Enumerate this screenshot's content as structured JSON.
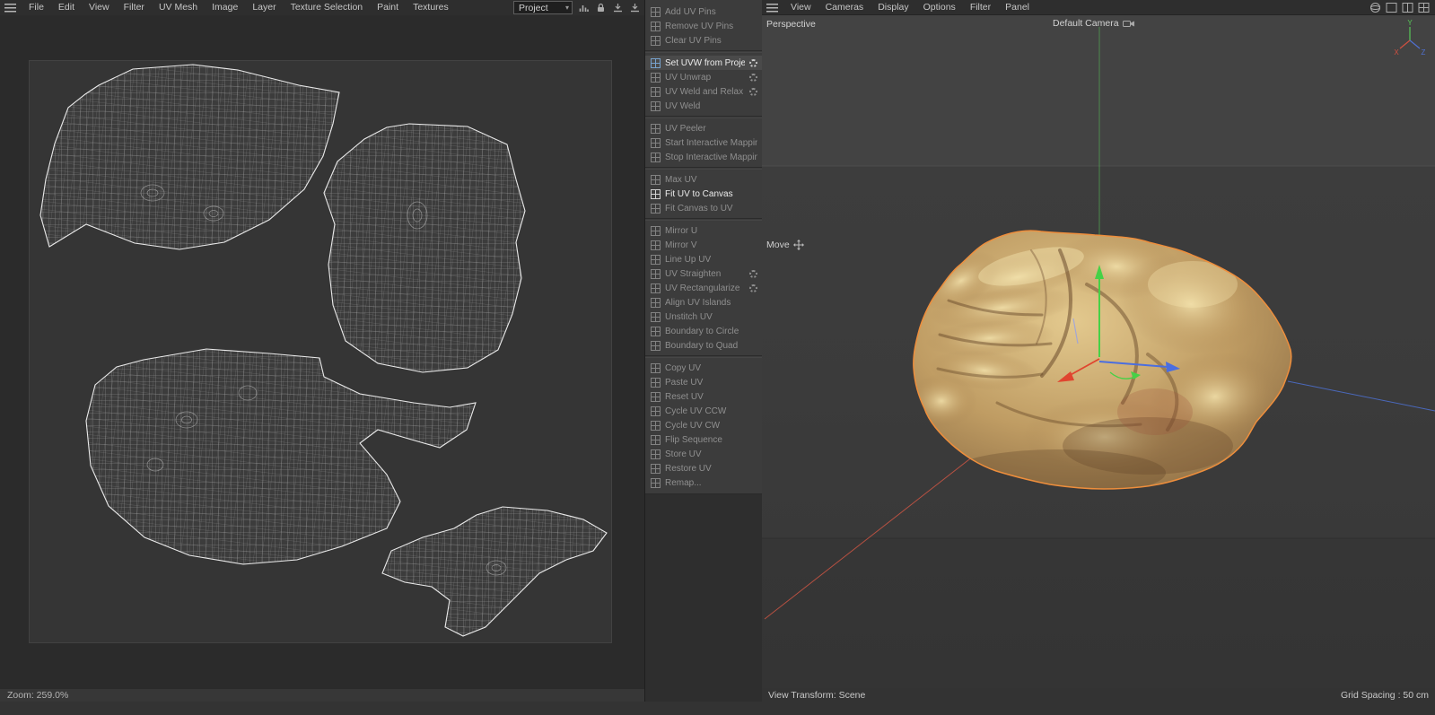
{
  "menubar": {
    "items": [
      "File",
      "Edit",
      "View",
      "Filter",
      "UV Mesh",
      "Image",
      "Layer",
      "Texture Selection",
      "Paint",
      "Textures"
    ]
  },
  "toolbar": {
    "project_label": "Project"
  },
  "uv_commands": [
    {
      "label": "Add UV Pins",
      "enabled": false,
      "gear": false,
      "sep_before": false
    },
    {
      "label": "Remove UV Pins",
      "enabled": false,
      "gear": false,
      "sep_before": false
    },
    {
      "label": "Clear UV Pins",
      "enabled": false,
      "gear": false,
      "sep_before": false
    },
    {
      "label": "Set UVW from Projection",
      "enabled": true,
      "highlight": true,
      "gear": true,
      "sep_before": true
    },
    {
      "label": "UV Unwrap",
      "enabled": false,
      "gear": true,
      "sep_before": false
    },
    {
      "label": "UV Weld and Relax",
      "enabled": false,
      "gear": true,
      "sep_before": false
    },
    {
      "label": "UV Weld",
      "enabled": false,
      "gear": false,
      "sep_before": false
    },
    {
      "label": "UV Peeler",
      "enabled": false,
      "gear": false,
      "sep_before": true
    },
    {
      "label": "Start Interactive Mapping",
      "enabled": false,
      "gear": false,
      "sep_before": false
    },
    {
      "label": "Stop Interactive Mapping",
      "enabled": false,
      "gear": false,
      "sep_before": false
    },
    {
      "label": "Max UV",
      "enabled": false,
      "gear": false,
      "sep_before": true
    },
    {
      "label": "Fit UV to Canvas",
      "enabled": true,
      "gear": false,
      "sep_before": false
    },
    {
      "label": "Fit Canvas to UV",
      "enabled": false,
      "gear": false,
      "sep_before": false
    },
    {
      "label": "Mirror U",
      "enabled": false,
      "gear": false,
      "sep_before": true
    },
    {
      "label": "Mirror V",
      "enabled": false,
      "gear": false,
      "sep_before": false
    },
    {
      "label": "Line Up UV",
      "enabled": false,
      "gear": false,
      "sep_before": false
    },
    {
      "label": "UV Straighten",
      "enabled": false,
      "gear": true,
      "sep_before": false
    },
    {
      "label": "UV Rectangularize",
      "enabled": false,
      "gear": true,
      "sep_before": false
    },
    {
      "label": "Align UV Islands",
      "enabled": false,
      "gear": false,
      "sep_before": false
    },
    {
      "label": "Unstitch UV",
      "enabled": false,
      "gear": false,
      "sep_before": false
    },
    {
      "label": "Boundary to Circle",
      "enabled": false,
      "gear": false,
      "sep_before": false
    },
    {
      "label": "Boundary to Quad",
      "enabled": false,
      "gear": false,
      "sep_before": false
    },
    {
      "label": "Copy UV",
      "enabled": false,
      "gear": false,
      "sep_before": true
    },
    {
      "label": "Paste UV",
      "enabled": false,
      "gear": false,
      "sep_before": false
    },
    {
      "label": "Reset UV",
      "enabled": false,
      "gear": false,
      "sep_before": false
    },
    {
      "label": "Cycle UV CCW",
      "enabled": false,
      "gear": false,
      "sep_before": false
    },
    {
      "label": "Cycle UV CW",
      "enabled": false,
      "gear": false,
      "sep_before": false
    },
    {
      "label": "Flip Sequence",
      "enabled": false,
      "gear": false,
      "sep_before": false
    },
    {
      "label": "Store UV",
      "enabled": false,
      "gear": false,
      "sep_before": false
    },
    {
      "label": "Restore UV",
      "enabled": false,
      "gear": false,
      "sep_before": false
    },
    {
      "label": "Remap...",
      "enabled": false,
      "gear": false,
      "sep_before": false
    }
  ],
  "uv_editor": {
    "zoom_status": "Zoom: 259.0%"
  },
  "viewport": {
    "menu_items": [
      "View",
      "Cameras",
      "Display",
      "Options",
      "Filter",
      "Panel"
    ],
    "view_label": "Perspective",
    "camera_label": "Default Camera",
    "tool_label": "Move",
    "axis": {
      "x": "X",
      "y": "Y",
      "z": "Z"
    },
    "status_left": "View Transform: Scene",
    "status_right": "Grid Spacing : 50 cm"
  },
  "colors": {
    "selection_outline": "#ee8e3c",
    "axis_x": "#d8452f",
    "axis_y": "#46d146",
    "axis_z": "#4a6ee0",
    "enabled_text": "#ececec",
    "disabled_text": "#8f8f8f"
  },
  "icons": {
    "main-menu-icon": "hamburger",
    "chevron-down-icon": "▾",
    "chart-icon": "bar chart",
    "lock-icon": "padlock",
    "dock-icon": "arrow into tray",
    "gear-icon": "settings gear",
    "camera-icon": "camera",
    "move-icon": "move cross",
    "axis-triad": "XYZ world axes",
    "render-sphere-icon": "sphere",
    "panel-layout-icon": "window layout"
  }
}
